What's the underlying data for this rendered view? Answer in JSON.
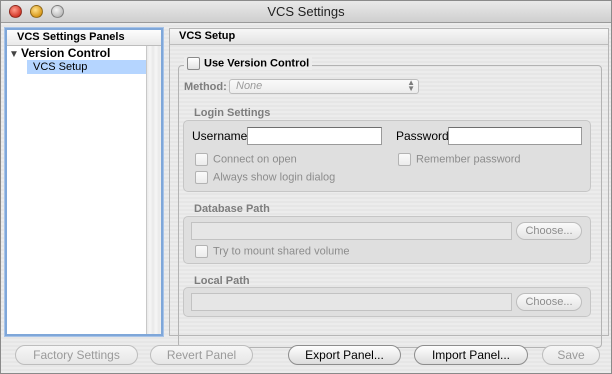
{
  "window": {
    "title": "VCS Settings"
  },
  "sidebar": {
    "header": "VCS Settings Panels",
    "group_label": "Version Control",
    "selected_item": "VCS Setup"
  },
  "panel": {
    "header": "VCS Setup",
    "use_vcs_label": "Use Version Control",
    "use_vcs_checked": false,
    "method_label": "Method:",
    "method_value": "None",
    "login": {
      "title": "Login Settings",
      "username_label": "Username",
      "username_value": "",
      "password_label": "Password",
      "password_value": "",
      "connect_on_open": "Connect on open",
      "remember_password": "Remember password",
      "always_show_login": "Always show login dialog"
    },
    "database": {
      "title": "Database Path",
      "path_value": "",
      "choose_label": "Choose...",
      "mount_shared": "Try to mount shared volume"
    },
    "local": {
      "title": "Local Path",
      "path_value": "",
      "choose_label": "Choose..."
    }
  },
  "buttons": {
    "factory_settings": "Factory Settings",
    "revert_panel": "Revert Panel",
    "export_panel": "Export Panel...",
    "import_panel": "Import Panel...",
    "save": "Save"
  }
}
